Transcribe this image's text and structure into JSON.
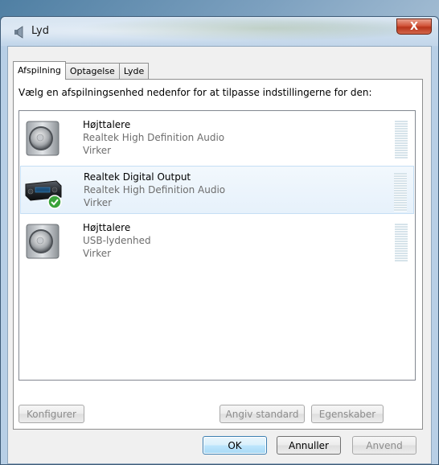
{
  "window": {
    "title": "Lyd",
    "close_glyph": "X"
  },
  "tabs": [
    {
      "label": "Afspilning",
      "active": true
    },
    {
      "label": "Optagelse",
      "active": false
    },
    {
      "label": "Lyde",
      "active": false
    }
  ],
  "playback": {
    "instruction": "Vælg en afspilningsenhed nedenfor for at tilpasse indstillingerne for den:",
    "devices": [
      {
        "name": "Højttalere",
        "description": "Realtek High Definition Audio",
        "status": "Virker",
        "icon": "speaker-icon",
        "selected": false,
        "is_default": false
      },
      {
        "name": "Realtek Digital Output",
        "description": "Realtek High Definition Audio",
        "status": "Virker",
        "icon": "digital-output-icon",
        "selected": true,
        "is_default": true
      },
      {
        "name": "Højttalere",
        "description": "USB-lydenhed",
        "status": "Virker",
        "icon": "speaker-icon",
        "selected": false,
        "is_default": false
      }
    ],
    "buttons": {
      "configure": "Konfigurer",
      "set_default": "Angiv standard",
      "properties": "Egenskaber"
    }
  },
  "dialog_buttons": {
    "ok": "OK",
    "cancel": "Annuller",
    "apply": "Anvend"
  },
  "colors": {
    "selection": "#e6f1fb",
    "default_check": "#3aa33a",
    "close_button": "#c8452c"
  }
}
